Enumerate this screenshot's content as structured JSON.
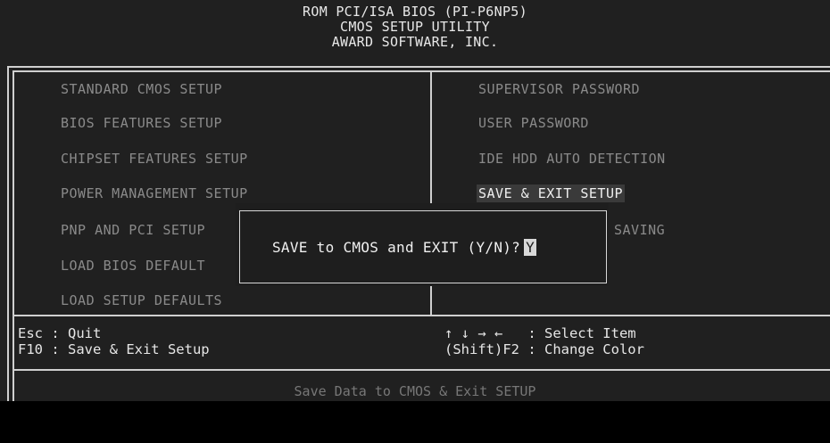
{
  "header": {
    "line1": "ROM PCI/ISA BIOS (PI-P6NP5)",
    "line2": "CMOS SETUP UTILITY",
    "line3": "AWARD SOFTWARE, INC."
  },
  "menu": {
    "left": [
      "STANDARD CMOS SETUP",
      "BIOS FEATURES SETUP",
      "CHIPSET FEATURES SETUP",
      "POWER MANAGEMENT SETUP",
      "PNP AND PCI SETUP",
      "LOAD BIOS DEFAULT",
      "LOAD SETUP DEFAULTS"
    ],
    "right": [
      "SUPERVISOR PASSWORD",
      "USER PASSWORD",
      "IDE HDD AUTO DETECTION",
      "SAVE & EXIT SETUP",
      "SAVING"
    ],
    "selected": "SAVE & EXIT SETUP"
  },
  "help": {
    "left_line1": "Esc : Quit",
    "left_line2": "F10 : Save & Exit Setup",
    "right_line1": "↑ ↓ → ←   : Select Item",
    "right_line2": "(Shift)F2 : Change Color"
  },
  "dialog": {
    "prompt": "SAVE to CMOS and EXIT (Y/N)?",
    "answer": "Y"
  },
  "status_line": "Save Data to CMOS & Exit SETUP"
}
